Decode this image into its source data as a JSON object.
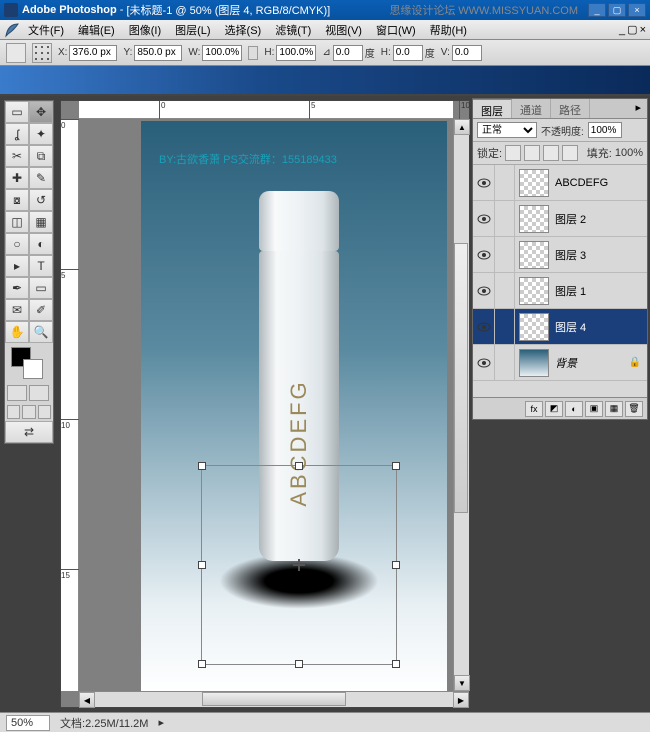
{
  "titlebar": {
    "app": "Adobe Photoshop",
    "doc": "[未标题-1 @ 50% (图层 4, RGB/8/CMYK)]",
    "watermark_site": "思缘设计论坛",
    "watermark_url": "WWW.MISSYUAN.COM"
  },
  "menu": {
    "file": "文件(F)",
    "edit": "编辑(E)",
    "image": "图像(I)",
    "layer": "图层(L)",
    "select": "选择(S)",
    "filter": "滤镜(T)",
    "view": "视图(V)",
    "window": "窗口(W)",
    "help": "帮助(H)"
  },
  "options": {
    "x_lbl": "X:",
    "x": "376.0 px",
    "y_lbl": "Y:",
    "y": "850.0 px",
    "w_lbl": "W:",
    "w": "100.0%",
    "h_lbl": "H:",
    "h": "100.0%",
    "a_lbl": "⊿",
    "a": "0.0",
    "a_unit": "度",
    "hskew_lbl": "H:",
    "hskew": "0.0",
    "hskew_unit": "度",
    "vskew_lbl": "V:",
    "vskew": "0.0"
  },
  "canvas": {
    "credit": "BY:古欲香萧 PS交流群：155189433",
    "bottle_text": "ABCDEFG",
    "rulers_h": [
      "0",
      "5",
      "10"
    ],
    "rulers_v": [
      "0",
      "5",
      "10",
      "15"
    ]
  },
  "layers_panel": {
    "tabs": {
      "layers": "图层",
      "channels": "通道",
      "paths": "路径"
    },
    "blend": "正常",
    "opacity_lbl": "不透明度:",
    "opacity": "100%",
    "lock_lbl": "锁定:",
    "fill_lbl": "填充:",
    "fill": "100%",
    "items": [
      {
        "name": "ABCDEFG",
        "thumb": "checker"
      },
      {
        "name": "图层 2",
        "thumb": "checker"
      },
      {
        "name": "图层 3",
        "thumb": "checker"
      },
      {
        "name": "图层 1",
        "thumb": "checker"
      },
      {
        "name": "图层 4",
        "thumb": "checker",
        "selected": true
      },
      {
        "name": "背景",
        "thumb": "grad",
        "italic": true,
        "locked": true
      }
    ]
  },
  "status": {
    "zoom": "50%",
    "doc_lbl": "文档:",
    "doc": "2.25M/11.2M"
  }
}
